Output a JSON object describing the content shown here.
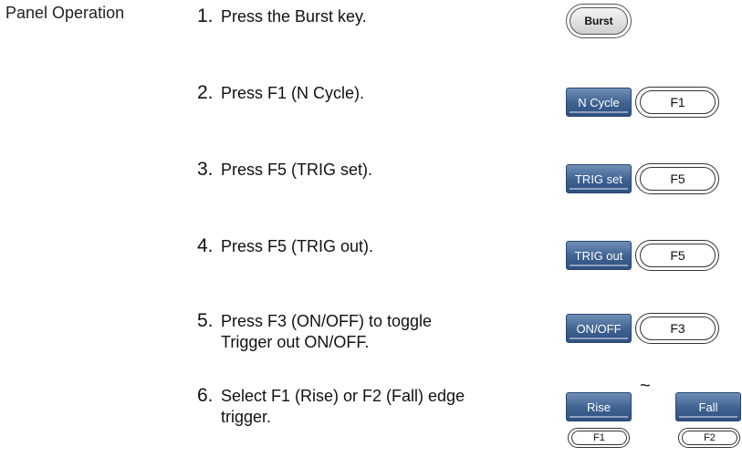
{
  "section_label": "Panel Operation",
  "steps": [
    {
      "num": "1.",
      "line1": "Press the Burst key."
    },
    {
      "num": "2.",
      "line1": "Press F1 (N Cycle)."
    },
    {
      "num": "3.",
      "line1": "Press F5 (TRIG set)."
    },
    {
      "num": "4.",
      "line1": "Press F5 (TRIG out)."
    },
    {
      "num": "5.",
      "line1": "Press F3 (ON/OFF) to toggle",
      "line2": "Trigger out ON/OFF."
    },
    {
      "num": "6.",
      "line1": "Select F1 (Rise) or F2 (Fall) edge",
      "line2": "trigger."
    }
  ],
  "keys": {
    "burst": "Burst",
    "n_cycle": "N Cycle",
    "trig_set": "TRIG set",
    "trig_out": "TRIG out",
    "on_off": "ON/OFF",
    "rise": "Rise",
    "fall": "Fall",
    "f1": "F1",
    "f2": "F2",
    "f3": "F3",
    "f5": "F5",
    "tilde": "~"
  }
}
